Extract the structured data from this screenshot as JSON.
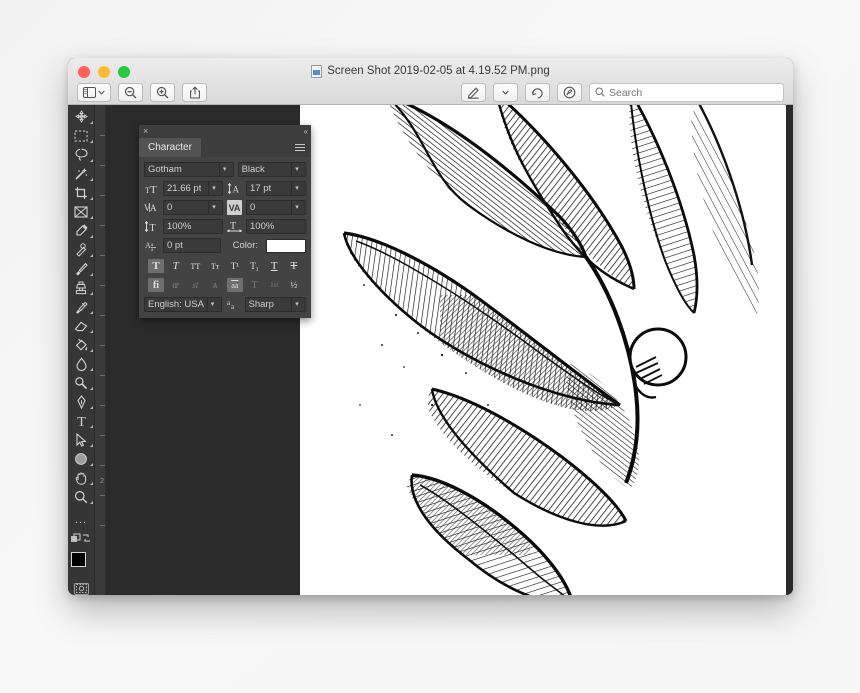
{
  "window": {
    "title": "Screen Shot 2019-02-05 at 4.19.52 PM.png",
    "title_icon": "png-file-icon",
    "lights": [
      {
        "name": "close-button",
        "color": "#ff5f57"
      },
      {
        "name": "minimize-button",
        "color": "#febc2e"
      },
      {
        "name": "zoom-button",
        "color": "#28c840"
      }
    ]
  },
  "toolbar": {
    "sidebar_toggle": "sidebar-icon",
    "sidebar_chevron": "chevron-down-icon",
    "zoom_out": "zoom-out-icon",
    "zoom_in": "zoom-in-icon",
    "share": "share-icon",
    "markup": "markup-pen-icon",
    "markup_chevron": "chevron-down-icon",
    "rotate": "rotate-icon",
    "annotate": "annotate-icon",
    "search": {
      "icon": "search-icon",
      "placeholder": "Search",
      "value": ""
    }
  },
  "tools": [
    {
      "name": "move-tool",
      "glyph": "move"
    },
    {
      "name": "marquee-tool",
      "glyph": "marquee"
    },
    {
      "name": "lasso-tool",
      "glyph": "lasso"
    },
    {
      "name": "magic-wand-tool",
      "glyph": "wand"
    },
    {
      "name": "crop-tool",
      "glyph": "crop"
    },
    {
      "name": "frame-tool",
      "glyph": "frame"
    },
    {
      "name": "eyedropper-tool",
      "glyph": "eyedropper"
    },
    {
      "name": "healing-brush-tool",
      "glyph": "healing"
    },
    {
      "name": "brush-tool",
      "glyph": "brush"
    },
    {
      "name": "clone-stamp-tool",
      "glyph": "stamp"
    },
    {
      "name": "history-brush-tool",
      "glyph": "history"
    },
    {
      "name": "eraser-tool",
      "glyph": "eraser"
    },
    {
      "name": "gradient-tool",
      "glyph": "bucket"
    },
    {
      "name": "blur-tool",
      "glyph": "blur"
    },
    {
      "name": "dodge-tool",
      "glyph": "dodge"
    },
    {
      "name": "pen-tool",
      "glyph": "pen"
    },
    {
      "name": "type-tool",
      "glyph": "T"
    },
    {
      "name": "path-selection-tool",
      "glyph": "arrow"
    },
    {
      "name": "ellipse-tool",
      "glyph": "ellipse"
    },
    {
      "name": "hand-tool",
      "glyph": "hand"
    },
    {
      "name": "zoom-tool",
      "glyph": "magnifier"
    }
  ],
  "tool_extras": {
    "more_tools": "...",
    "screen_mode": "screen-mode-icon",
    "swap_colors": "swap-colors-icon",
    "foreground_color": "#000000",
    "background_color": "#ffffff",
    "quick_mask": "quick-mask-icon"
  },
  "ruler": {
    "labels": [
      "2"
    ]
  },
  "character_panel": {
    "close": "×",
    "collapse": "«",
    "tab_label": "Character",
    "menu": "panel-menu-icon",
    "font_family": "Gotham",
    "font_style": "Black",
    "font_size": "21.66 pt",
    "leading": "17 pt",
    "tracking": "0",
    "kerning": "0",
    "vertical_scale": "100%",
    "horizontal_scale": "100%",
    "baseline_shift": "0 pt",
    "color_label": "Color:",
    "color_value": "#ffffff",
    "language": "English: USA",
    "antialias": "Sharp",
    "style_buttons_row1": [
      {
        "name": "faux-bold-button",
        "glyph": "T",
        "state": "on"
      },
      {
        "name": "faux-italic-button",
        "glyph": "T",
        "state": "off"
      },
      {
        "name": "all-caps-button",
        "glyph": "TT",
        "state": "off"
      },
      {
        "name": "small-caps-button",
        "glyph": "Tт",
        "state": "off"
      },
      {
        "name": "superscript-button",
        "glyph": "T¹",
        "state": "off"
      },
      {
        "name": "subscript-button",
        "glyph": "T₁",
        "state": "off"
      },
      {
        "name": "underline-button",
        "glyph": "T",
        "state": "off"
      },
      {
        "name": "strikethrough-button",
        "glyph": "T",
        "state": "off"
      }
    ],
    "style_buttons_row2": [
      {
        "name": "standard-ligatures-button",
        "glyph": "fi",
        "state": "on"
      },
      {
        "name": "contextual-alternates-button",
        "glyph": "œ",
        "state": "dim"
      },
      {
        "name": "discretionary-ligatures-button",
        "glyph": "st",
        "state": "dim"
      },
      {
        "name": "swash-button",
        "glyph": "ᴀ",
        "state": "dim"
      },
      {
        "name": "old-style-button",
        "glyph": "aa",
        "state": "on"
      },
      {
        "name": "titling-alternates-button",
        "glyph": "T",
        "state": "dim"
      },
      {
        "name": "ordinals-button",
        "glyph": "1st",
        "state": "dim"
      },
      {
        "name": "fractions-button",
        "glyph": "½",
        "state": "off"
      }
    ]
  },
  "artwork": {
    "name": "engraved-leaf-illustration",
    "description": "Black and white hatched engraving of leaves and a bud"
  }
}
